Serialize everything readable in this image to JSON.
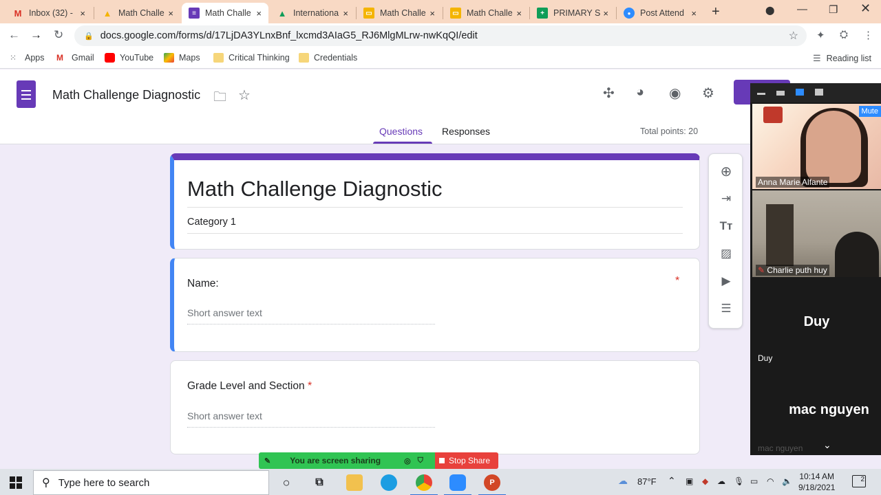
{
  "browser": {
    "tabs": [
      {
        "label": "Inbox (32) -",
        "icon": "gmail-icon",
        "color": "#d93025",
        "glyph": "M"
      },
      {
        "label": "Math Challe",
        "icon": "drive-icon",
        "color": "#f4b400",
        "glyph": "▲"
      },
      {
        "label": "Math Challe",
        "icon": "forms-icon",
        "color": "#673ab7",
        "glyph": "≡"
      },
      {
        "label": "Internationa",
        "icon": "drive-icon",
        "color": "#0f9d58",
        "glyph": "▲"
      },
      {
        "label": "Math Challe",
        "icon": "slides-icon",
        "color": "#f4b400",
        "glyph": "▭"
      },
      {
        "label": "Math Challe",
        "icon": "slides-icon",
        "color": "#f4b400",
        "glyph": "▭"
      },
      {
        "label": "PRIMARY S",
        "icon": "sheets-icon",
        "color": "#0f9d58",
        "glyph": "+"
      },
      {
        "label": "Post Attend",
        "icon": "zoom-icon",
        "color": "#2d8cff",
        "glyph": "●"
      }
    ],
    "close_glyph": "×",
    "new_tab_glyph": "+",
    "url": "docs.google.com/forms/d/17LjDA3YLnxBnf_lxcmd3AIaG5_RJ6MlgMLrw-nwKqQI/edit",
    "bookmarks": [
      {
        "label": "Apps"
      },
      {
        "label": "Gmail"
      },
      {
        "label": "YouTube"
      },
      {
        "label": "Maps"
      },
      {
        "label": "Critical Thinking"
      },
      {
        "label": "Credentials"
      }
    ],
    "reading_list": "Reading list"
  },
  "form": {
    "doc_title": "Math Challenge Diagnostic",
    "tabs": {
      "questions": "Questions",
      "responses": "Responses"
    },
    "total_points": "Total points: 20",
    "title": "Math Challenge Diagnostic",
    "description": "Category 1",
    "questions": [
      {
        "title": "Name:",
        "placeholder": "Short answer text",
        "required_mark": "*"
      },
      {
        "title": "Grade Level and Section",
        "placeholder": "Short answer text",
        "required_mark": "*"
      }
    ],
    "accent": "#673ab7",
    "active_border": "#4285f4"
  },
  "zoom": {
    "mute_label": "Mute",
    "participants": [
      {
        "name": "Anna Marie Alfante"
      },
      {
        "name": "Charlie puth huy"
      },
      {
        "name": "Duy",
        "display": "Duy"
      },
      {
        "name": "mac nguyen",
        "display": "mac nguyen"
      }
    ],
    "share_text": "You are screen sharing",
    "stop_share": "Stop Share"
  },
  "taskbar": {
    "search_placeholder": "Type here to search",
    "weather": "87°F",
    "time": "10:14 AM",
    "date": "9/18/2021",
    "notifications": "2"
  }
}
